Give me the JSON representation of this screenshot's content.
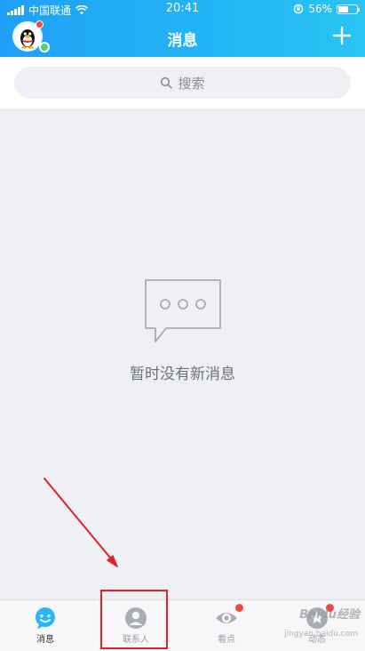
{
  "status_bar": {
    "carrier": "中国联通",
    "time": "20:41",
    "battery": "56%",
    "battery_level": 0.56
  },
  "header": {
    "title": "消息"
  },
  "search": {
    "placeholder": "搜索"
  },
  "empty_state": {
    "message": "暂时没有新消息"
  },
  "tabs": [
    {
      "label": "消息",
      "icon": "chat-bubble-icon",
      "active": true
    },
    {
      "label": "联系人",
      "icon": "contact-person-icon",
      "active": false
    },
    {
      "label": "看点",
      "icon": "eye-icon",
      "active": false,
      "badge": true
    },
    {
      "label": "动态",
      "icon": "star-icon",
      "active": false,
      "badge": true
    }
  ],
  "watermark": {
    "brand": "Baidu经验",
    "url": "jingyan.baidu.com"
  },
  "colors": {
    "header_start": "#1fa0f6",
    "header_end": "#29c4f2",
    "badge": "#f04a3e",
    "online": "#4fd36b",
    "annotation": "#e0212b"
  }
}
